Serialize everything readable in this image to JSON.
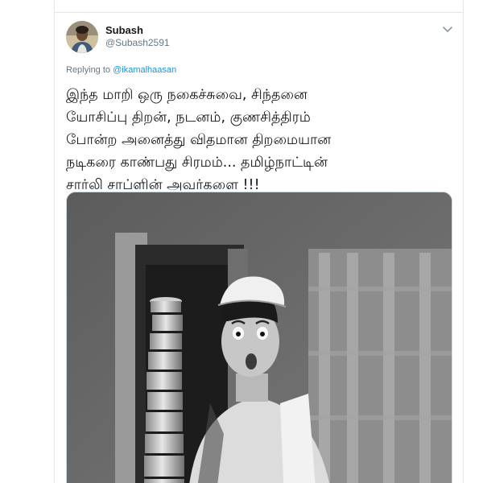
{
  "tweet": {
    "author": {
      "display_name": "Subash",
      "handle": "@Subash2591"
    },
    "reply_prefix": "Replying to ",
    "reply_to": "@ikamalhaasan",
    "text_lines": [
      "இந்த மாறி ஒரு நகைச்சுவை, சிந்தனை",
      "யோசிப்பு திறன், நடனம், குணசித்திரம்",
      "போன்ற அனைத்து விதமான திறமையான",
      "நடிகரை காண்பது சிரமம்... தமிழ்நாட்டின்",
      "சார்லி சாப்ளின் அவர்களை !!!"
    ],
    "media": {
      "description_icon": "black-and-white-film-still"
    }
  },
  "icons": {
    "caret": "chevron-down-icon",
    "avatar": "avatar"
  },
  "colors": {
    "link": "#1b95e0",
    "muted": "#657786",
    "border": "#e1e8ed"
  }
}
